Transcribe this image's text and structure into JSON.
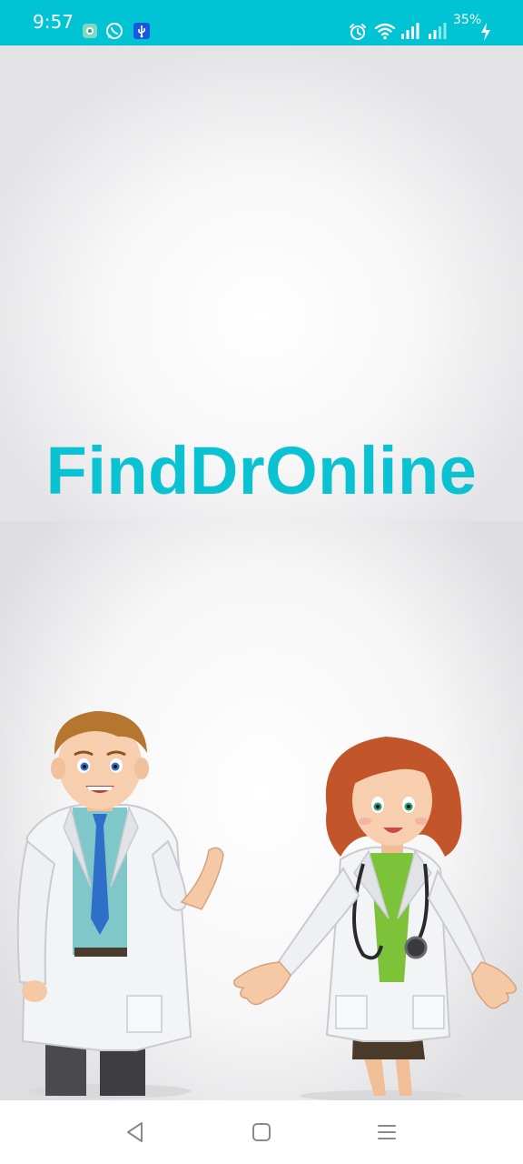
{
  "status_bar": {
    "time": "9:57",
    "battery": "35%",
    "background_color": "#00C4D4",
    "icons": [
      "chat-bubble-icon",
      "whatsapp-icon",
      "usb-icon",
      "alarm-icon",
      "wifi-icon",
      "signal-icon",
      "signal-icon",
      "charging-bolt-icon"
    ]
  },
  "splash": {
    "app_name": "FindDrOnline",
    "brand_color": "#0BC2D3",
    "illustration": [
      "male-doctor",
      "female-doctor"
    ]
  },
  "nav_bar": {
    "buttons": [
      "back-icon",
      "home-icon",
      "recents-icon"
    ]
  }
}
